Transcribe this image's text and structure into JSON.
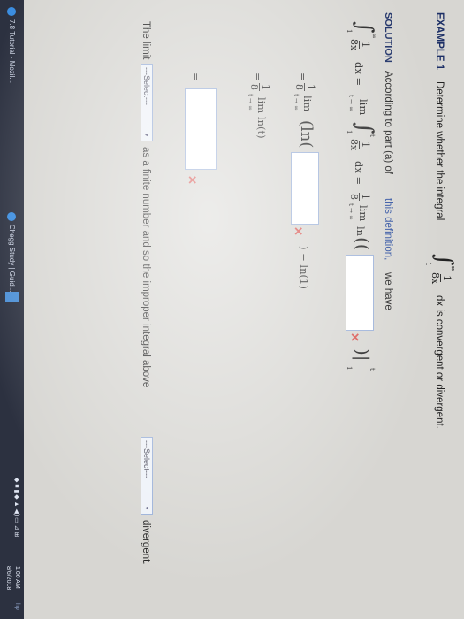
{
  "example": {
    "label": "EXAMPLE 1",
    "question_pre": "Determine whether the integral",
    "question_post": "dx  is convergent or divergent.",
    "integrand_num": "1",
    "integrand_den": "8x",
    "lower": "1",
    "upper": "∞"
  },
  "solution": {
    "label": "SOLUTION",
    "intro_pre": "According to part (a) of",
    "intro_link": "this definition,",
    "intro_post": "we have"
  },
  "steps": {
    "line1_dx": "dx  =",
    "lim": "lim",
    "t_to_inf": "t → ∞",
    "upper_t": "t",
    "eq": "=",
    "coef_num": "1",
    "coef_den": "8",
    "ln": "ln",
    "ln_open": "(",
    "ln_close": ")",
    "ln1": ") − ln(1)",
    "lnt": "lim  ln(t)",
    "eval_bar": ")|",
    "eval_t": "t",
    "eval_1": "1"
  },
  "conclusion": {
    "pre": "The limit",
    "select1": "---Select---",
    "mid": "as a finite number and so the improper integral above",
    "select2": "---Select---",
    "post": "divergent."
  },
  "taskbar": {
    "item1": "7.8 Tutorial - Mozil...",
    "item2": "Chegg Study | Guid...",
    "time": "1:06 AM",
    "date": "8/6/2018",
    "brand": "hp"
  },
  "colors": {
    "heading": "#1c2f66",
    "link": "#2a4d9e",
    "error_x": "#d9534f",
    "input_border": "#9ab0d8"
  }
}
